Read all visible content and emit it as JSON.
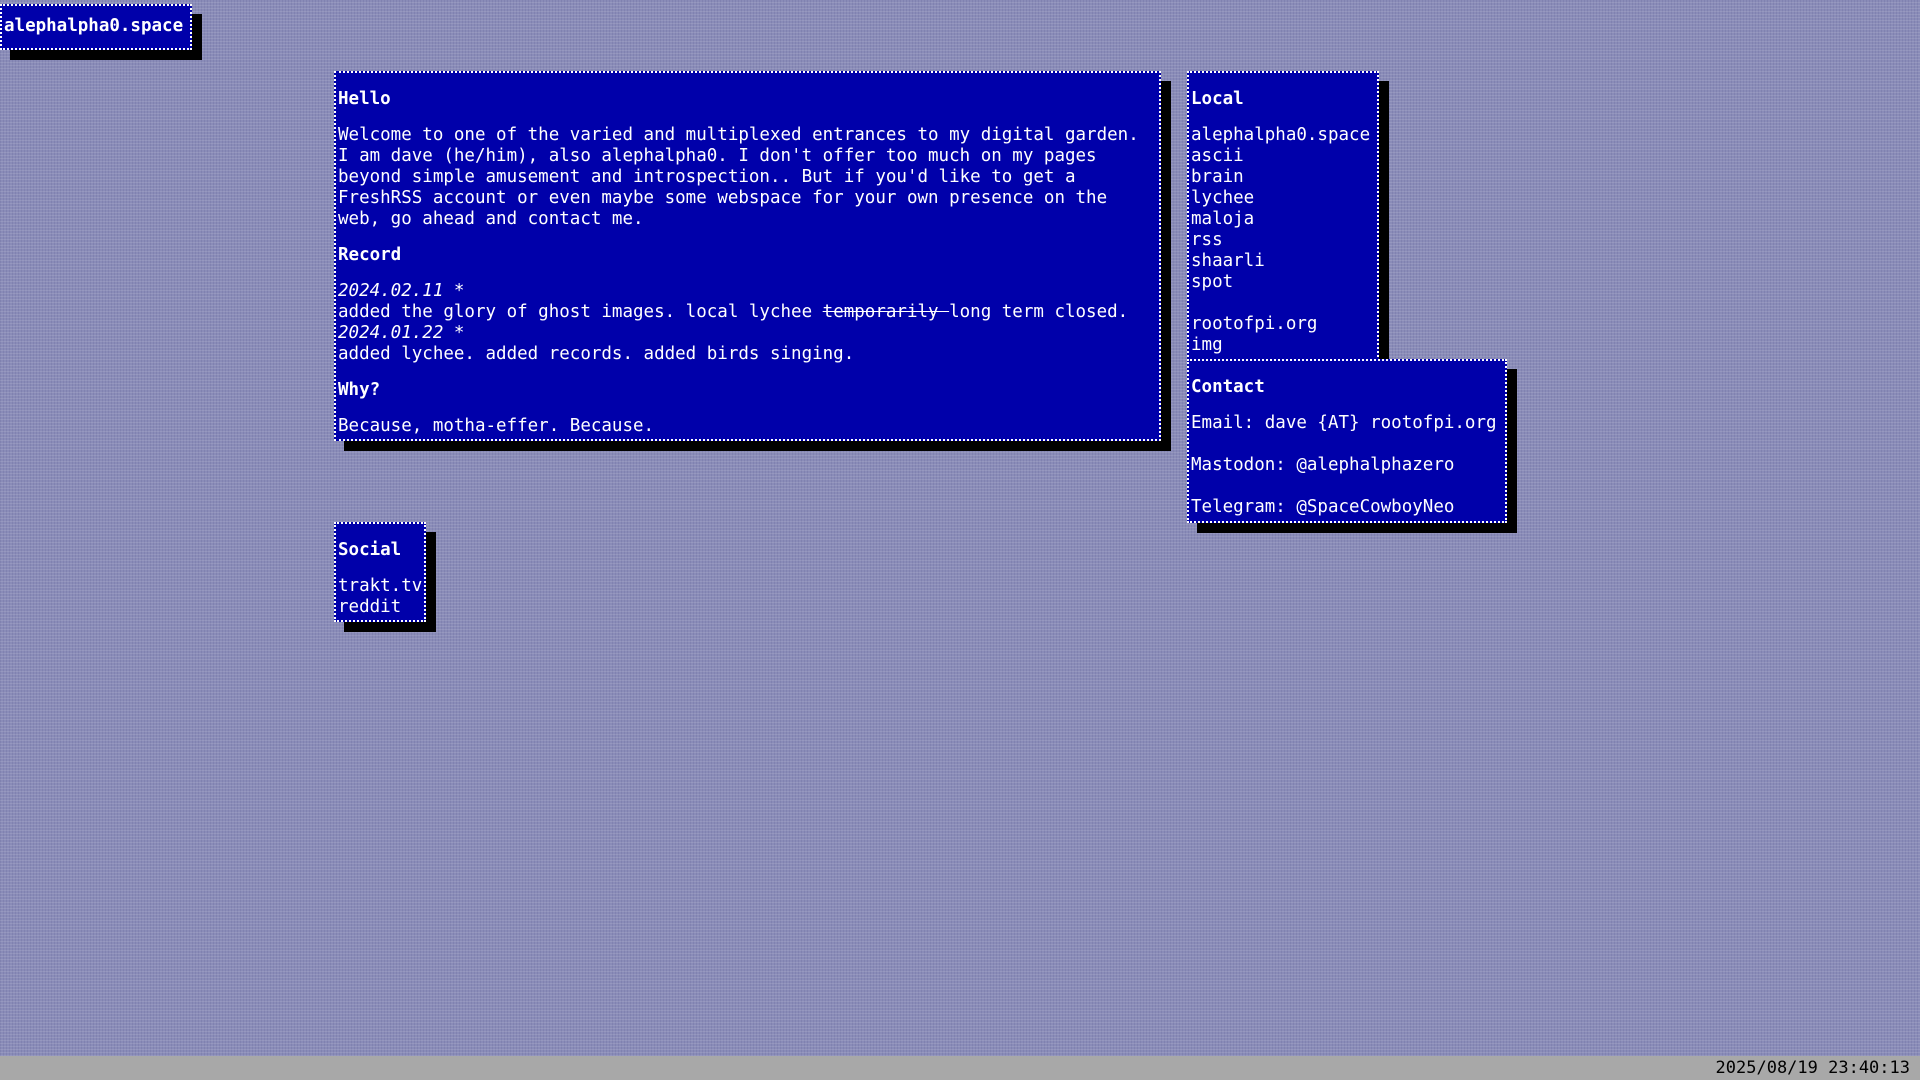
{
  "site_title": "alephalpha0.space",
  "hello": {
    "heading": "Hello",
    "intro": "Welcome to one of the varied and multiplexed entrances to my digital garden. I am dave (he/him), also alephalpha0. I don't offer too much on my pages beyond simple amusement and introspection.. But if you'd like to get a FreshRSS account or even maybe some webspace for your own presence on the web, go ahead and contact me.",
    "record_heading": "Record",
    "record": [
      {
        "date": "2024.02.11 *",
        "text_before": "added the glory of ghost images. local lychee ",
        "struck": "temporarily ",
        "text_after": "long term closed."
      },
      {
        "date": "2024.01.22 *",
        "text_before": "added lychee. added records. added birds singing.",
        "struck": "",
        "text_after": ""
      }
    ],
    "why_heading": "Why?",
    "why_text": "Because, motha-effer. Because."
  },
  "local": {
    "heading": "Local",
    "links": [
      "alephalpha0.space",
      "ascii",
      "brain",
      "lychee",
      "maloja",
      "rss",
      "shaarli",
      "spot"
    ],
    "links2": [
      "rootofpi.org",
      "img"
    ]
  },
  "contact": {
    "heading": "Contact",
    "email": "Email: dave {AT} rootofpi.org",
    "mastodon": "Mastodon: @alephalphazero",
    "telegram": "Telegram: @SpaceCowboyNeo"
  },
  "social": {
    "heading": "Social",
    "links": [
      "trakt.tv",
      "reddit"
    ]
  },
  "status": {
    "clock": "2025/08/19 23:40:13"
  },
  "colors": {
    "window_bg": "#0000aa",
    "desktop_bg": "#8a8cb8",
    "statusbar_bg": "#a8a8a8"
  }
}
